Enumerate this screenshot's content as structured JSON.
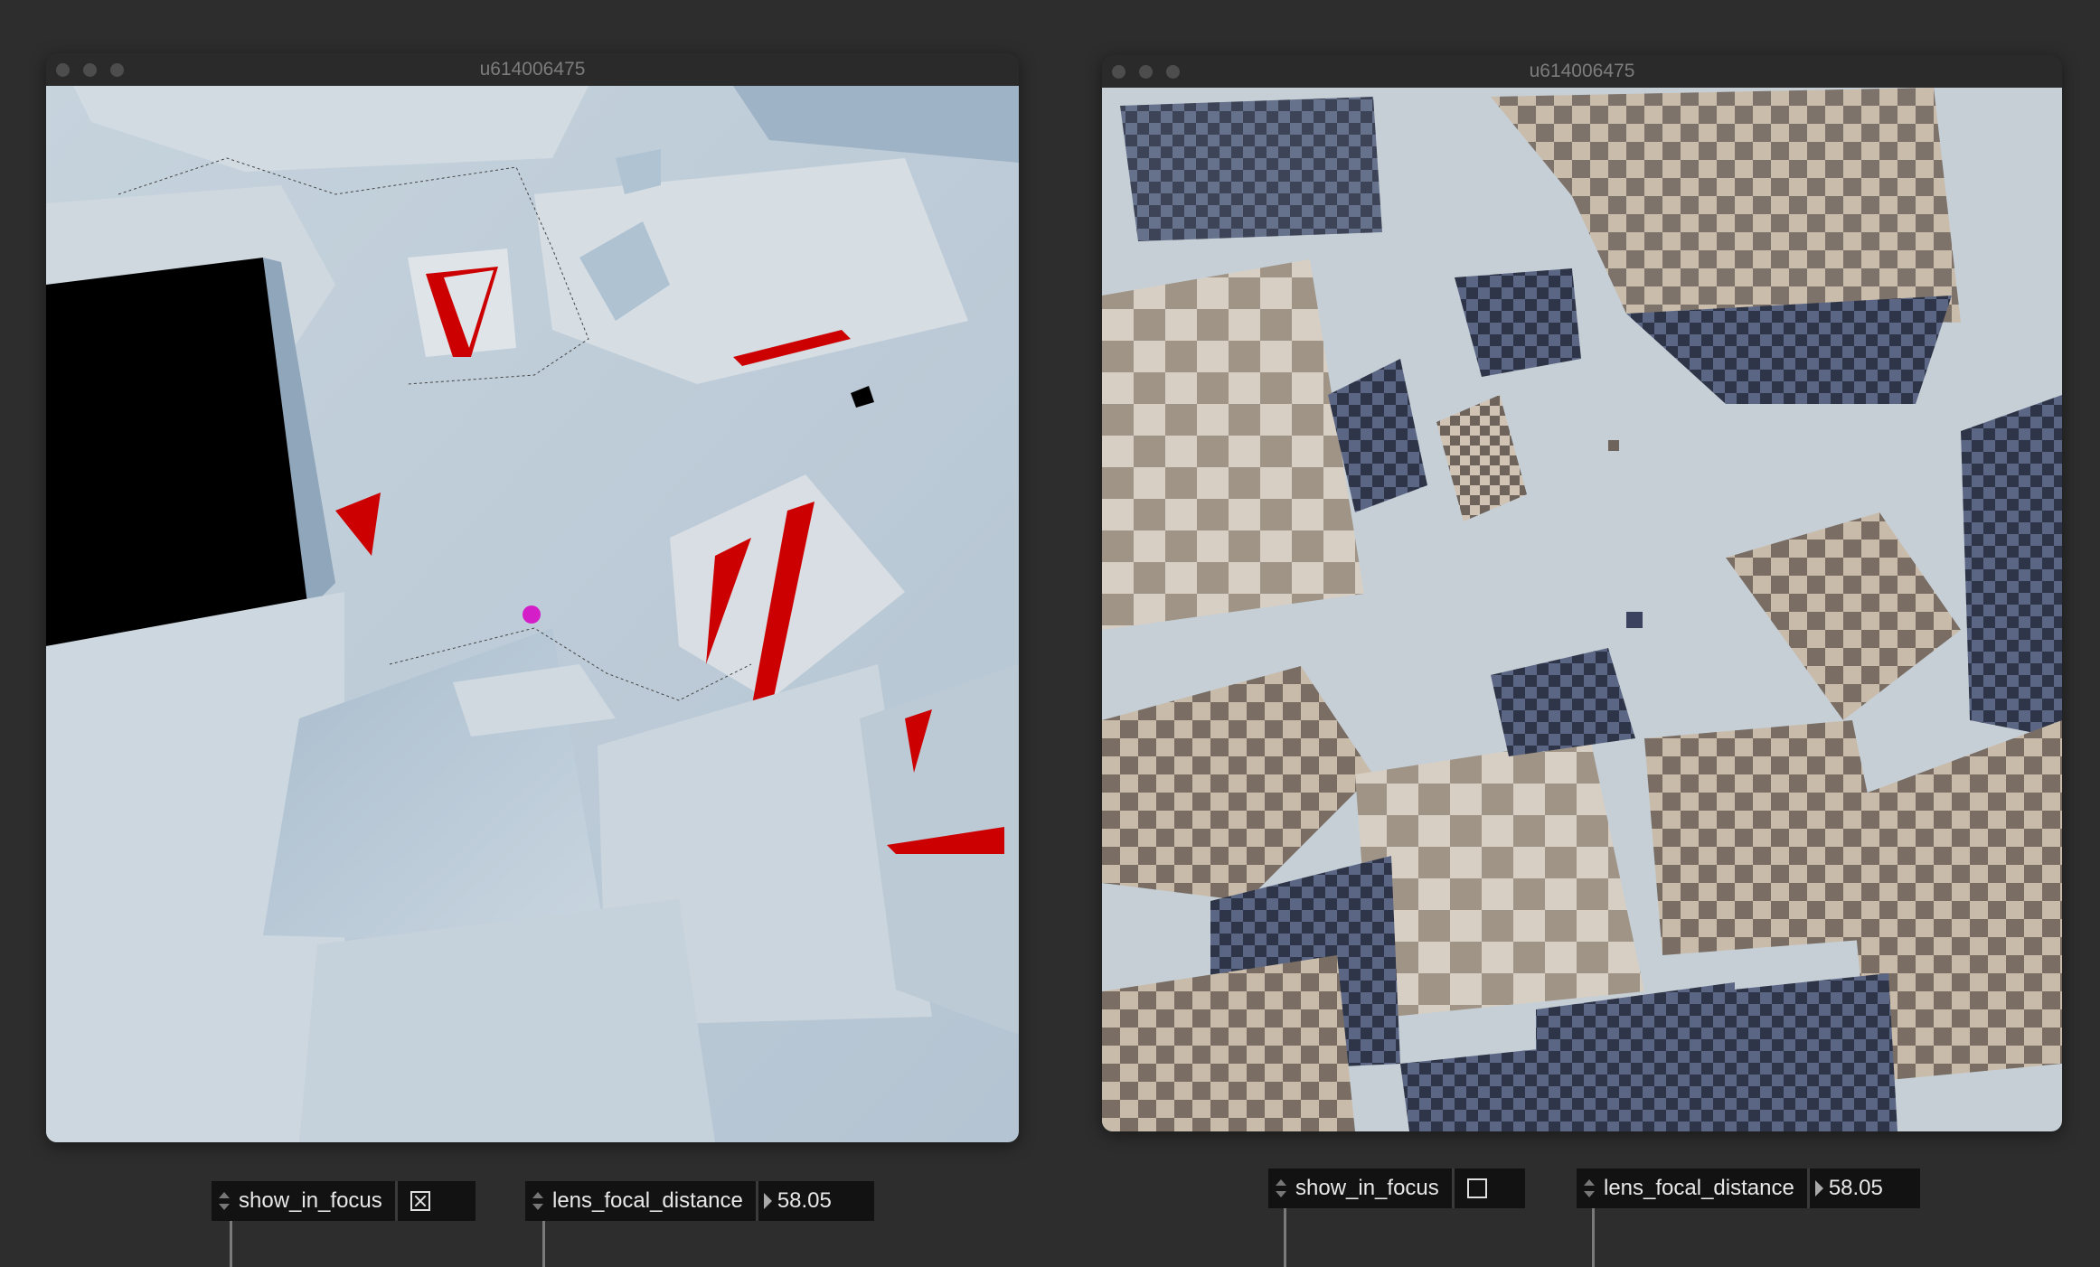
{
  "windows": [
    {
      "title": "u614006475"
    },
    {
      "title": "u614006475"
    }
  ],
  "params": {
    "left": {
      "show_in_focus": {
        "label": "show_in_focus",
        "checked": true
      },
      "lens_focal_distance": {
        "label": "lens_focal_distance",
        "value": "58.05"
      }
    },
    "right": {
      "show_in_focus": {
        "label": "show_in_focus",
        "checked": false
      },
      "lens_focal_distance": {
        "label": "lens_focal_distance",
        "value": "58.05"
      }
    }
  },
  "colors": {
    "background": "#2d2d2d",
    "focus_marker": "#d41ec8",
    "in_focus_highlight": "#cc0000"
  }
}
